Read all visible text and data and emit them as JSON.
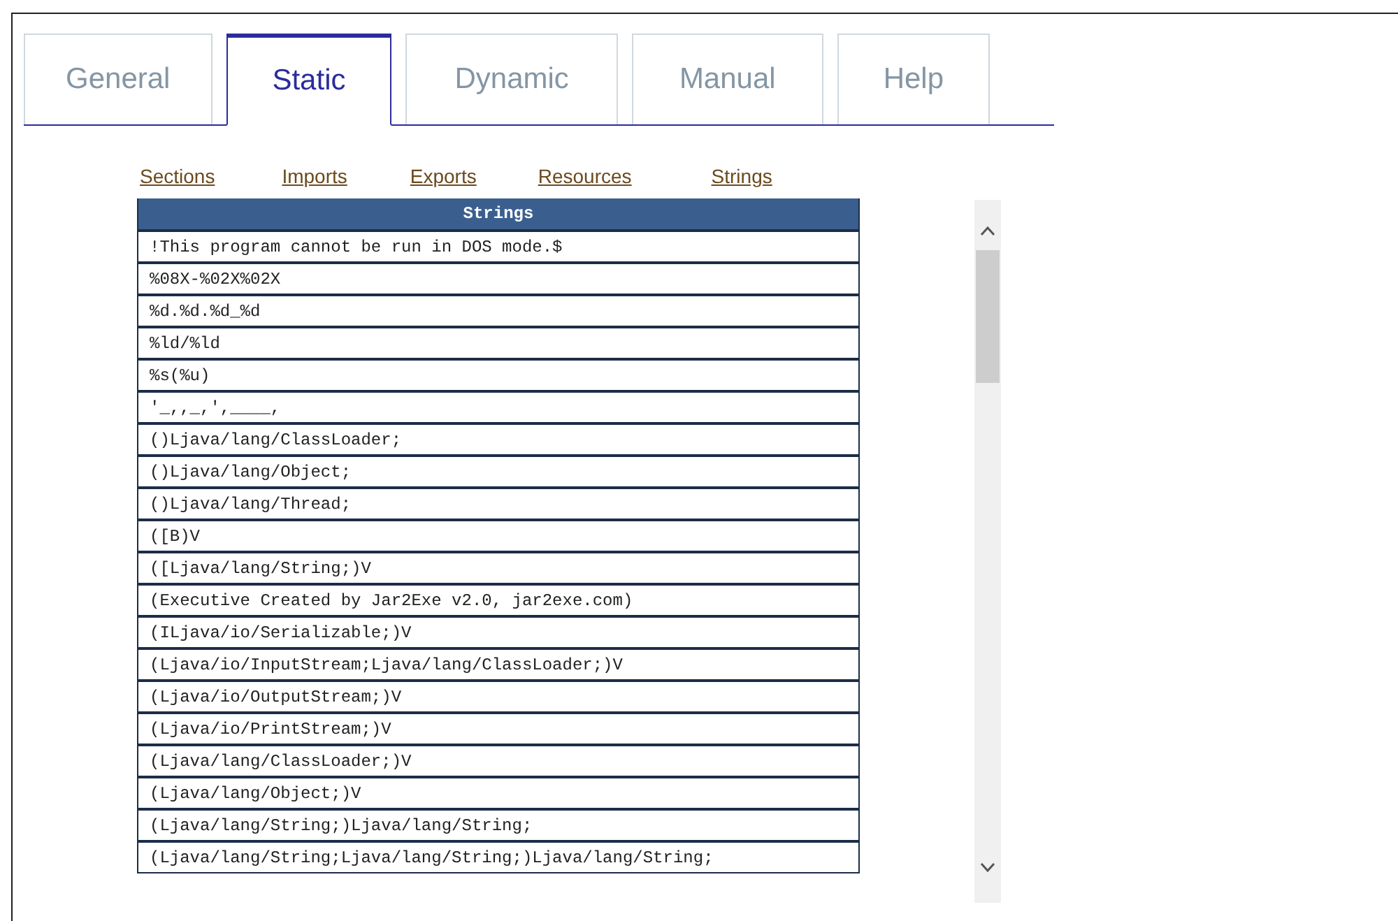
{
  "tabs": [
    {
      "label": "General",
      "selected": false
    },
    {
      "label": "Static",
      "selected": true
    },
    {
      "label": "Dynamic",
      "selected": false
    },
    {
      "label": "Manual",
      "selected": false
    },
    {
      "label": "Help",
      "selected": false
    }
  ],
  "links": [
    "Sections",
    "Imports",
    "Exports",
    "Resources",
    "Strings"
  ],
  "table": {
    "header": "Strings",
    "rows": [
      "!This program cannot be run in DOS mode.$",
      "%08X-%02X%02X",
      "%d.%d.%d_%d",
      "%ld/%ld",
      "%s(%u)",
      "'_,,_,',____,",
      "()Ljava/lang/ClassLoader;",
      "()Ljava/lang/Object;",
      "()Ljava/lang/Thread;",
      "([B)V",
      "([Ljava/lang/String;)V",
      "(Executive Created by Jar2Exe v2.0, jar2exe.com)",
      "(ILjava/io/Serializable;)V",
      "(Ljava/io/InputStream;Ljava/lang/ClassLoader;)V",
      "(Ljava/io/OutputStream;)V",
      "(Ljava/io/PrintStream;)V",
      "(Ljava/lang/ClassLoader;)V",
      "(Ljava/lang/Object;)V",
      "(Ljava/lang/String;)Ljava/lang/String;",
      "(Ljava/lang/String;Ljava/lang/String;)Ljava/lang/String;"
    ]
  }
}
